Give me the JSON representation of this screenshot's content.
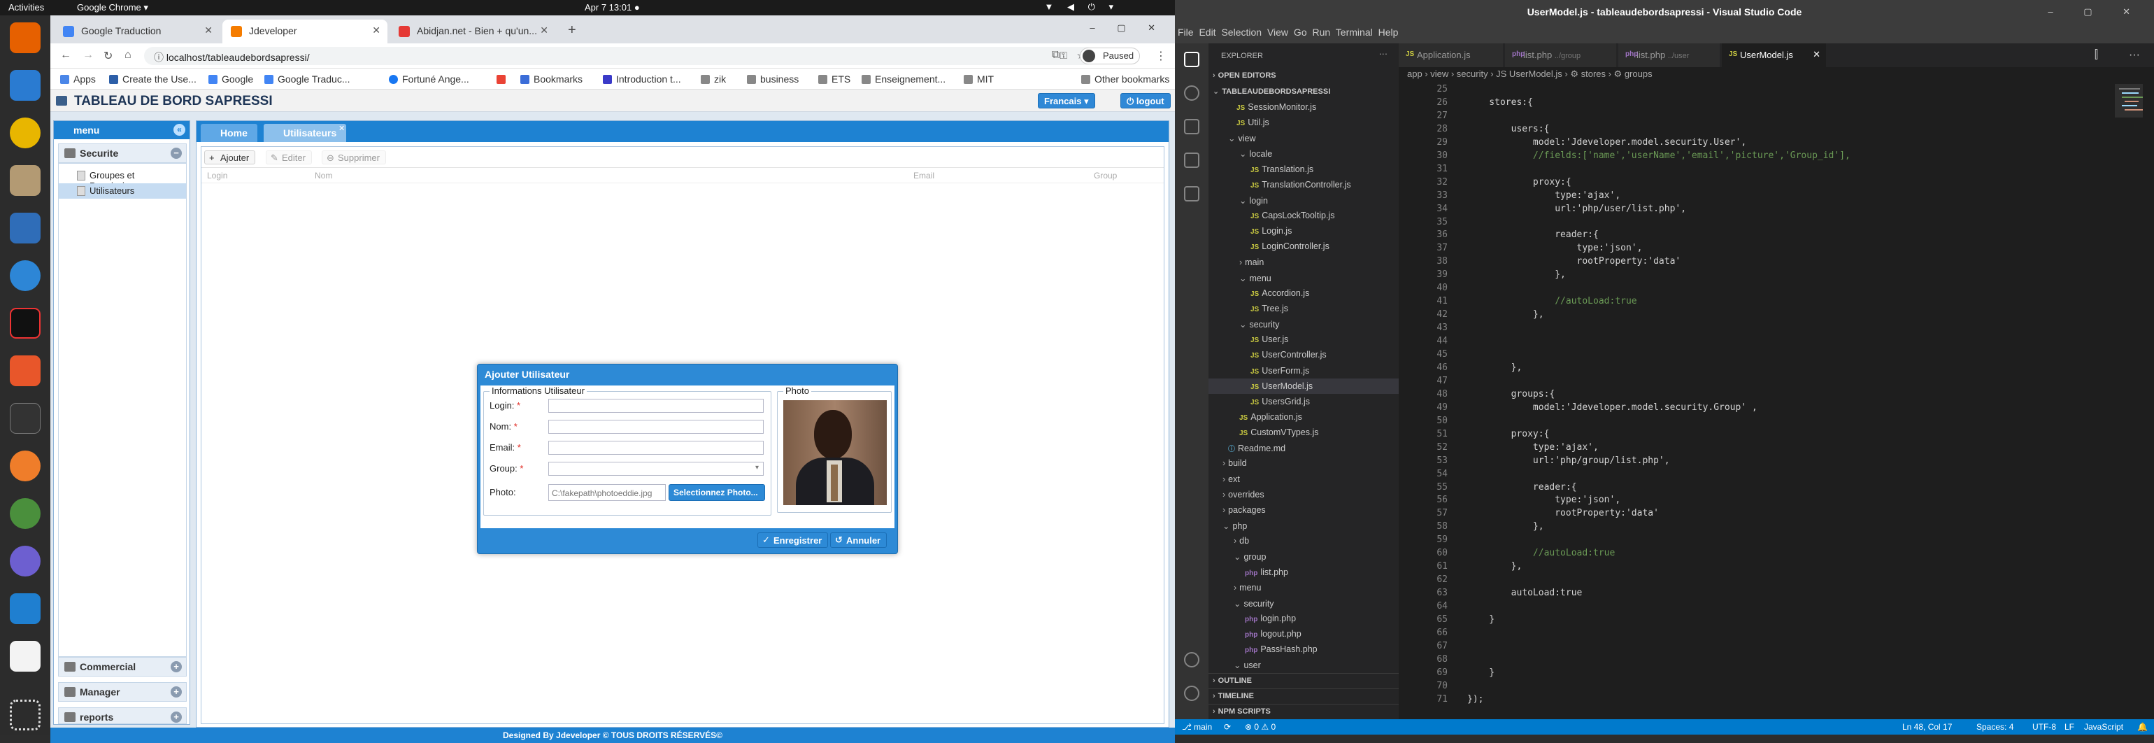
{
  "topbar": {
    "activities": "Activities",
    "app": "Google Chrome ▾",
    "clock": "Apr 7  13:01  ●"
  },
  "browser": {
    "tabs": [
      {
        "label": "Google Traduction"
      },
      {
        "label": "Jdeveloper"
      },
      {
        "label": "Abidjan.net - Bien + qu'un..."
      }
    ],
    "url_host": "localhost",
    "url_path": "/tableaudebordsapressi/",
    "profile": "Paused",
    "bookmarks": [
      "Apps",
      "Create the Use...",
      "Google",
      "Google Traduc...",
      "Fortuné Ange...",
      "",
      "Bookmarks",
      "Introduction t...",
      "zik",
      "business",
      "ETS",
      "Enseignement...",
      "MIT",
      "Other bookmarks"
    ]
  },
  "app": {
    "title": "TABLEAU DE BORD SAPRESSI",
    "lang": "Francais",
    "logout": "logout",
    "menu": "menu",
    "securite": "Securite",
    "tree": [
      "Groupes et Permissions",
      "Utilisateurs"
    ],
    "commercial": "Commercial",
    "manager": "Manager",
    "reports": "reports",
    "tab_home": "Home",
    "tab_users": "Utilisateurs",
    "tb_add": "Ajouter",
    "tb_edit": "Editer",
    "tb_delete": "Supprimer",
    "cols": [
      "Login",
      "Nom",
      "Email",
      "Group"
    ],
    "footer": "Designed By Jdeveloper © TOUS DROITS RÉSERVÉS©"
  },
  "modal": {
    "title": "Ajouter Utilisateur",
    "info_legend": "Informations Utilisateur",
    "photo_legend": "Photo",
    "login": "Login:",
    "nom": "Nom:",
    "email": "Email:",
    "group": "Group:",
    "photo": "Photo:",
    "req": "*",
    "file_value": "C:\\fakepath\\photoeddie.jpg",
    "select_photo": "Selectionnez Photo...",
    "save": "Enregistrer",
    "cancel": "Annuler"
  },
  "vscode": {
    "title": "UserModel.js - tableaudebordsapressi - Visual Studio Code",
    "menu": "File  Edit  Selection  View  Go  Run  Terminal  Help",
    "explorer": "EXPLORER",
    "open_editors": "OPEN EDITORS",
    "project": "TABLEAUDEBORDSAPRESSI",
    "tree": [
      {
        "t": "SessionMonitor.js",
        "ind": 20,
        "k": "js"
      },
      {
        "t": "Util.js",
        "ind": 20,
        "k": "js"
      },
      {
        "t": "view",
        "ind": 14,
        "k": "dir"
      },
      {
        "t": "locale",
        "ind": 22,
        "k": "dir"
      },
      {
        "t": "Translation.js",
        "ind": 30,
        "k": "js"
      },
      {
        "t": "TranslationController.js",
        "ind": 30,
        "k": "js"
      },
      {
        "t": "login",
        "ind": 22,
        "k": "dir"
      },
      {
        "t": "CapsLockTooltip.js",
        "ind": 30,
        "k": "js"
      },
      {
        "t": "Login.js",
        "ind": 30,
        "k": "js"
      },
      {
        "t": "LoginController.js",
        "ind": 30,
        "k": "js"
      },
      {
        "t": "main",
        "ind": 22,
        "k": "cdir"
      },
      {
        "t": "menu",
        "ind": 22,
        "k": "dir"
      },
      {
        "t": "Accordion.js",
        "ind": 30,
        "k": "js"
      },
      {
        "t": "Tree.js",
        "ind": 30,
        "k": "js"
      },
      {
        "t": "security",
        "ind": 22,
        "k": "dir"
      },
      {
        "t": "User.js",
        "ind": 30,
        "k": "js"
      },
      {
        "t": "UserController.js",
        "ind": 30,
        "k": "js"
      },
      {
        "t": "UserForm.js",
        "ind": 30,
        "k": "js"
      },
      {
        "t": "UserModel.js",
        "ind": 30,
        "k": "js",
        "sel": true
      },
      {
        "t": "UsersGrid.js",
        "ind": 30,
        "k": "js"
      },
      {
        "t": "Application.js",
        "ind": 22,
        "k": "js"
      },
      {
        "t": "CustomVTypes.js",
        "ind": 22,
        "k": "js"
      },
      {
        "t": "Readme.md",
        "ind": 14,
        "k": "md"
      },
      {
        "t": "build",
        "ind": 10,
        "k": "cdir"
      },
      {
        "t": "ext",
        "ind": 10,
        "k": "cdir"
      },
      {
        "t": "overrides",
        "ind": 10,
        "k": "cdir"
      },
      {
        "t": "packages",
        "ind": 10,
        "k": "cdir"
      },
      {
        "t": "php",
        "ind": 10,
        "k": "dir"
      },
      {
        "t": "db",
        "ind": 18,
        "k": "cdir"
      },
      {
        "t": "group",
        "ind": 18,
        "k": "dir"
      },
      {
        "t": "list.php",
        "ind": 26,
        "k": "php"
      },
      {
        "t": "menu",
        "ind": 18,
        "k": "cdir"
      },
      {
        "t": "security",
        "ind": 18,
        "k": "dir"
      },
      {
        "t": "login.php",
        "ind": 26,
        "k": "php"
      },
      {
        "t": "logout.php",
        "ind": 26,
        "k": "php"
      },
      {
        "t": "PassHash.php",
        "ind": 26,
        "k": "php"
      },
      {
        "t": "user",
        "ind": 18,
        "k": "dir"
      }
    ],
    "outline": "OUTLINE",
    "timeline": "TIMELINE",
    "npm": "NPM SCRIPTS",
    "tabs": [
      {
        "label": "Application.js",
        "k": "js"
      },
      {
        "label": "list.php",
        "hint": "../group",
        "k": "php"
      },
      {
        "label": "list.php",
        "hint": "../user",
        "k": "php"
      },
      {
        "label": "UserModel.js",
        "k": "js"
      }
    ],
    "breadcrumb": "app › view › security › JS UserModel.js › ⚙ stores › ⚙ groups",
    "lines": [
      {
        "n": "25",
        "t": ""
      },
      {
        "n": "26",
        "t": "    stores:{"
      },
      {
        "n": "27",
        "t": ""
      },
      {
        "n": "28",
        "t": "        users:{"
      },
      {
        "n": "29",
        "t": "            model:'Jdeveloper.model.security.User',"
      },
      {
        "n": "30",
        "t": "            //fields:['name','userName','email','picture','Group_id'],"
      },
      {
        "n": "31",
        "t": ""
      },
      {
        "n": "32",
        "t": "            proxy:{"
      },
      {
        "n": "33",
        "t": "                type:'ajax',"
      },
      {
        "n": "34",
        "t": "                url:'php/user/list.php',"
      },
      {
        "n": "35",
        "t": ""
      },
      {
        "n": "36",
        "t": "                reader:{"
      },
      {
        "n": "37",
        "t": "                    type:'json',"
      },
      {
        "n": "38",
        "t": "                    rootProperty:'data'"
      },
      {
        "n": "39",
        "t": "                },"
      },
      {
        "n": "40",
        "t": ""
      },
      {
        "n": "41",
        "t": "                //autoLoad:true"
      },
      {
        "n": "42",
        "t": "            },"
      },
      {
        "n": "43",
        "t": ""
      },
      {
        "n": "44",
        "t": ""
      },
      {
        "n": "45",
        "t": ""
      },
      {
        "n": "46",
        "t": "        },"
      },
      {
        "n": "47",
        "t": ""
      },
      {
        "n": "48",
        "t": "        groups:{"
      },
      {
        "n": "49",
        "t": "            model:'Jdeveloper.model.security.Group' ,"
      },
      {
        "n": "50",
        "t": ""
      },
      {
        "n": "51",
        "t": "        proxy:{"
      },
      {
        "n": "52",
        "t": "            type:'ajax',"
      },
      {
        "n": "53",
        "t": "            url:'php/group/list.php',"
      },
      {
        "n": "54",
        "t": ""
      },
      {
        "n": "55",
        "t": "            reader:{"
      },
      {
        "n": "56",
        "t": "                type:'json',"
      },
      {
        "n": "57",
        "t": "                rootProperty:'data'"
      },
      {
        "n": "58",
        "t": "            },"
      },
      {
        "n": "59",
        "t": ""
      },
      {
        "n": "60",
        "t": "            //autoLoad:true"
      },
      {
        "n": "61",
        "t": "        },"
      },
      {
        "n": "62",
        "t": ""
      },
      {
        "n": "63",
        "t": "        autoLoad:true"
      },
      {
        "n": "64",
        "t": ""
      },
      {
        "n": "65",
        "t": "    }"
      },
      {
        "n": "66",
        "t": ""
      },
      {
        "n": "67",
        "t": ""
      },
      {
        "n": "68",
        "t": ""
      },
      {
        "n": "69",
        "t": "    }"
      },
      {
        "n": "70",
        "t": ""
      },
      {
        "n": "71",
        "t": "});"
      }
    ],
    "status": {
      "branch": "⎇ main",
      "sync": "⟳",
      "errors": "⊗ 0 ⚠ 0",
      "pos": "Ln 48, Col 17",
      "spaces": "Spaces: 4",
      "enc": "UTF-8",
      "eol": "LF",
      "lang": "JavaScript"
    }
  }
}
